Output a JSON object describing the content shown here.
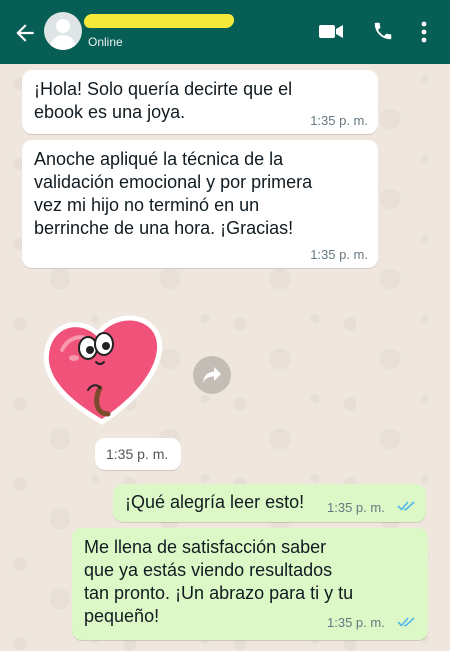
{
  "header": {
    "status": "Online",
    "icons": [
      "back-arrow-icon",
      "avatar",
      "video-call-icon",
      "phone-icon",
      "more-vert-icon"
    ],
    "colors": {
      "bar": "#075e54",
      "name_redaction": "#f5ea3c"
    }
  },
  "messages": [
    {
      "direction": "incoming",
      "text": "¡Hola! Solo quería decirte que el\nebook es una joya.",
      "time": "1:35 p. m."
    },
    {
      "direction": "incoming",
      "text": "Anoche apliqué la técnica de la\nvalidación emocional y por primera\nvez mi hijo no terminó en un\nberrinche de una hora. ¡Gracias!",
      "time": "1:35 p. m."
    },
    {
      "direction": "incoming",
      "type": "sticker",
      "sticker": "heart-character-sticker",
      "time": "1:35 p. m."
    },
    {
      "direction": "outgoing",
      "text": "¡Qué alegría leer esto!",
      "time": "1:35 p. m.",
      "status": "read"
    },
    {
      "direction": "outgoing",
      "text": "Me llena de satisfacción saber\nque ya estás viendo resultados\ntan pronto. ¡Un abrazo para ti y tu\npequeño!",
      "time": "1:35 p. m.",
      "status": "read"
    }
  ],
  "colors": {
    "incoming": "#ffffff",
    "outgoing": "#dcf8c6",
    "read_ticks": "#4fb6ec",
    "wallpaper": "#efe7de"
  }
}
